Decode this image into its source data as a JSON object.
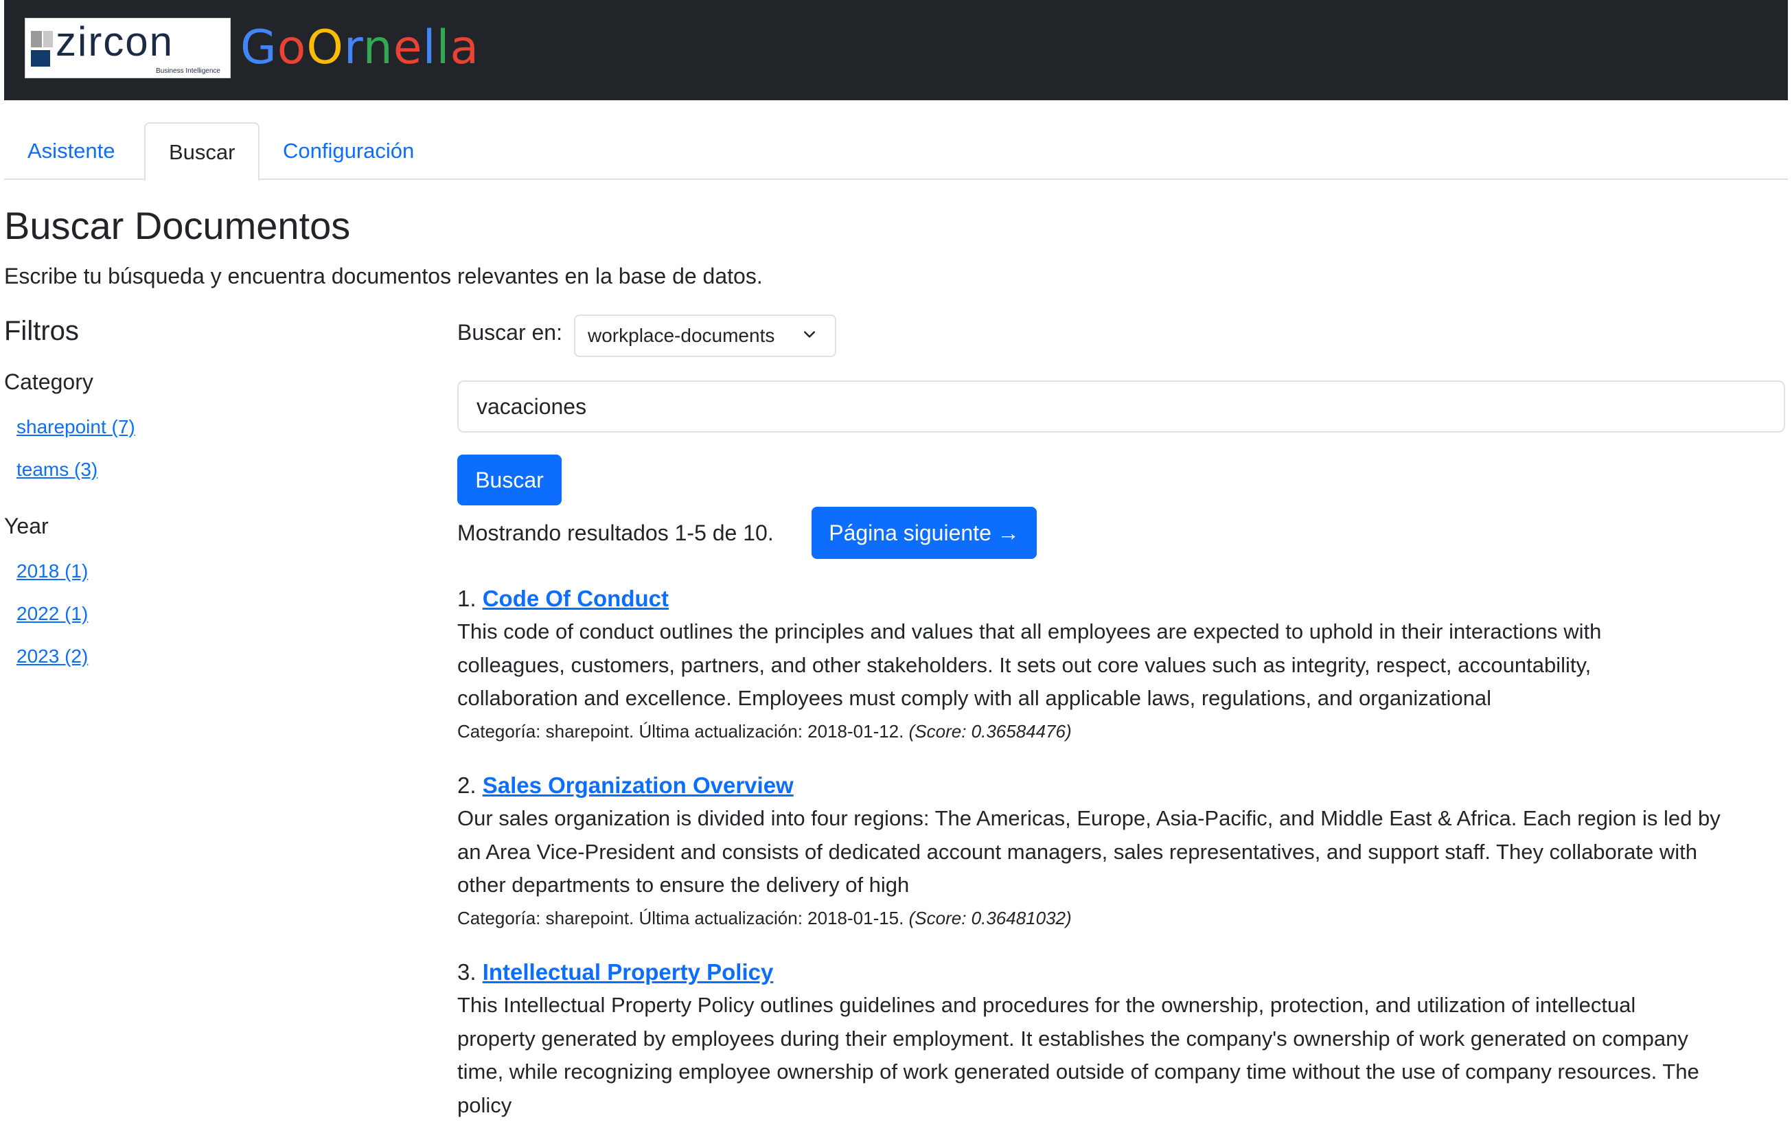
{
  "header": {
    "logo_text": "zircon",
    "logo_tagline": "Business Intelligence",
    "brand_letters": [
      {
        "ch": "G",
        "color": "#4285F4"
      },
      {
        "ch": "o",
        "color": "#EA4335"
      },
      {
        "ch": "O",
        "color": "#FBBC05"
      },
      {
        "ch": "r",
        "color": "#4285F4"
      },
      {
        "ch": "n",
        "color": "#34A853"
      },
      {
        "ch": "e",
        "color": "#EA4335"
      },
      {
        "ch": "l",
        "color": "#4285F4"
      },
      {
        "ch": "l",
        "color": "#34A853"
      },
      {
        "ch": "a",
        "color": "#EA4335"
      }
    ]
  },
  "tabs": [
    {
      "label": "Asistente",
      "active": false
    },
    {
      "label": "Buscar",
      "active": true
    },
    {
      "label": "Configuración",
      "active": false
    }
  ],
  "page": {
    "title": "Buscar Documentos",
    "description": "Escribe tu búsqueda y encuentra documentos relevantes en la base de datos."
  },
  "filters": {
    "title": "Filtros",
    "groups": [
      {
        "title": "Category",
        "items": [
          "sharepoint (7)",
          "teams (3)"
        ]
      },
      {
        "title": "Year",
        "items": [
          "2018 (1)",
          "2022 (1)",
          "2023 (2)"
        ]
      }
    ]
  },
  "search": {
    "buscar_en_label": "Buscar en:",
    "index_selected": "workplace-documents",
    "query": "vacaciones",
    "button_label": "Buscar",
    "showing_text": "Mostrando resultados 1-5 de 10.",
    "next_page_label": "Página siguiente →"
  },
  "results": [
    {
      "number": "1.",
      "title": "Code Of Conduct",
      "lines": [
        "This code of conduct outlines the principles and values that all employees are expected to uphold in their interactions with",
        "colleagues, customers, partners, and other stakeholders. It sets out core values such as integrity, respect, accountability,",
        "collaboration and excellence. Employees must comply with all applicable laws, regulations, and organizational"
      ],
      "meta": "Categoría: sharepoint. Última actualización: 2018-01-12.",
      "score": "(Score: 0.36584476)"
    },
    {
      "number": "2.",
      "title": "Sales Organization Overview",
      "lines": [
        "Our sales organization is divided into four regions: The Americas, Europe, Asia-Pacific, and Middle East & Africa. Each region is led by",
        "an Area Vice-President and consists of dedicated account managers, sales representatives, and support staff. They collaborate with",
        "other departments to ensure the delivery of high"
      ],
      "meta": "Categoría: sharepoint. Última actualización: 2018-01-15.",
      "score": "(Score: 0.36481032)"
    },
    {
      "number": "3.",
      "title": "Intellectual Property Policy",
      "lines": [
        "This Intellectual Property Policy outlines guidelines and procedures for the ownership, protection, and utilization of intellectual",
        "property generated by employees during their employment. It establishes the company's ownership of work generated on company",
        "time, while recognizing employee ownership of work generated outside of company time without the use of company resources. The",
        "policy"
      ],
      "meta": "",
      "score": ""
    }
  ]
}
